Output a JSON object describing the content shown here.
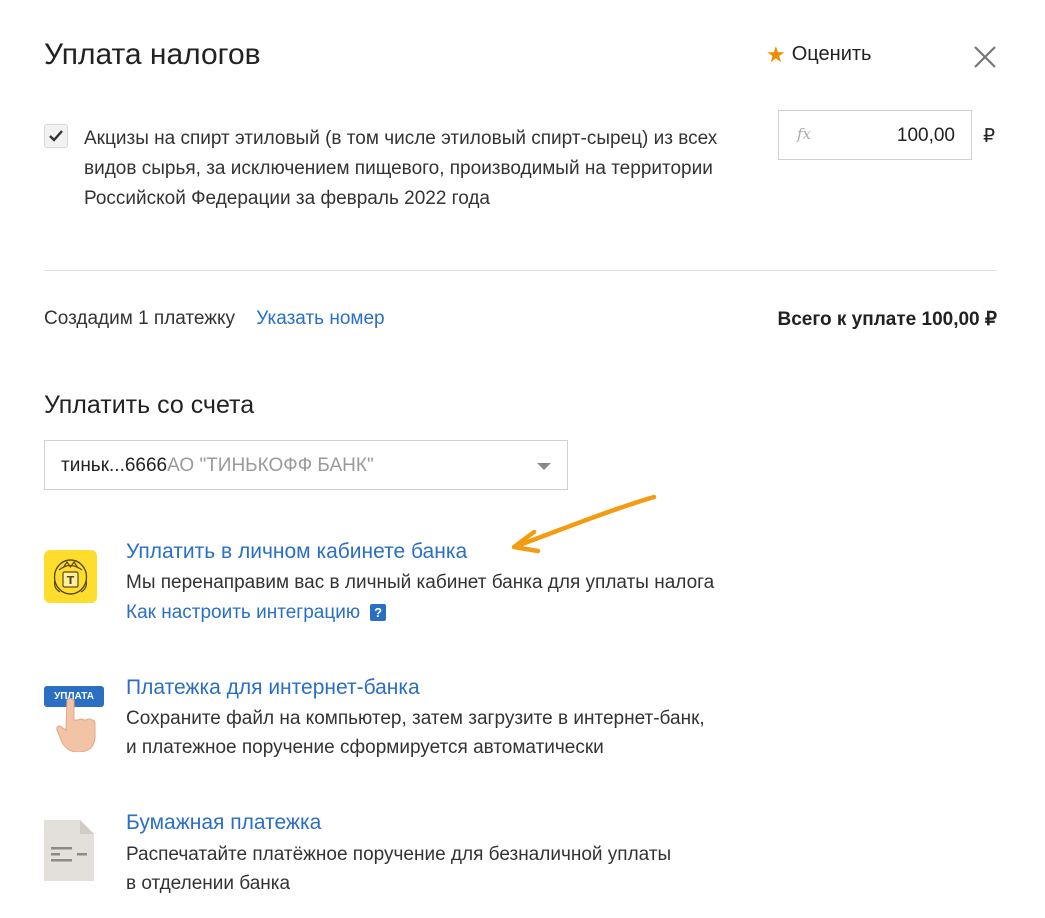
{
  "header": {
    "title": "Уплата налогов",
    "rate_label": "Оценить"
  },
  "tax_item": {
    "checked": true,
    "description": "Акцизы на спирт этиловый (в том числе этиловый спирт-сырец) из всех видов сырья, за исключением пищевого, производимый на территории Российской Федерации за февраль 2022 года",
    "formula_icon": "fx",
    "amount": "100,00",
    "currency": "₽"
  },
  "summary": {
    "payments_text": "Создадим 1 платежку",
    "specify_number_link": "Указать номер",
    "total_label": "Всего к уплате 100,00 ₽"
  },
  "pay_from": {
    "heading": "Уплатить со счета",
    "account_short": "тиньк...6666",
    "bank_name": "АО \"ТИНЬКОФФ БАНК\""
  },
  "options": [
    {
      "icon": "tinkoff-bank-logo",
      "title": "Уплатить в личном кабинете банка",
      "description": "Мы перенаправим вас в личный кабинет банка для уплаты налога",
      "help_link": "Как настроить интеграцию",
      "help_icon": "?"
    },
    {
      "icon": "pay-button-hand-icon",
      "icon_text": "УПЛАТА",
      "title": "Платежка для интернет-банка",
      "description_line1": "Сохраните файл на компьютер, затем загрузите в интернет-банк,",
      "description_line2": "и платежное поручение сформируется автоматически"
    },
    {
      "icon": "paper-document-icon",
      "title": "Бумажная платежка",
      "description_line1": "Распечатайте платёжное поручение для безналичной уплаты",
      "description_line2": "в отделении банка"
    }
  ],
  "colors": {
    "link": "#2a6fc4",
    "star": "#f28c00",
    "annotation_arrow": "#f39c12",
    "tinkoff_yellow": "#ffdd2d"
  }
}
